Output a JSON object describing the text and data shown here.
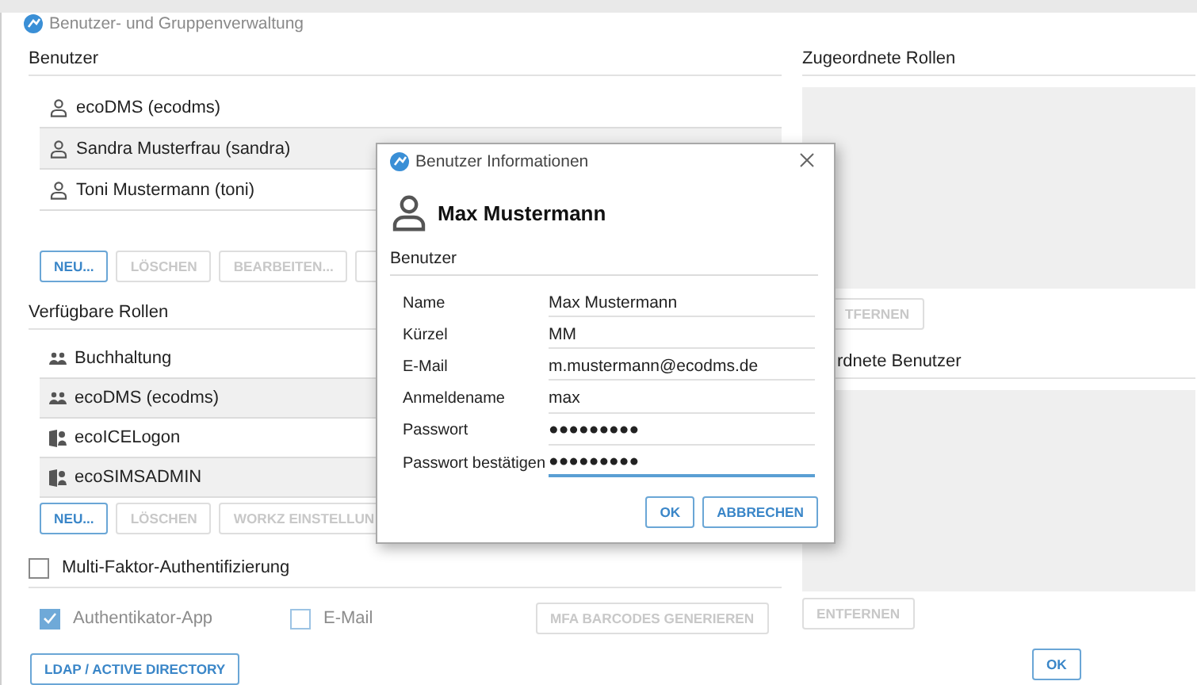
{
  "window": {
    "title": "Benutzer- und Gruppenverwaltung"
  },
  "users": {
    "title": "Benutzer",
    "items": [
      {
        "name": "ecoDMS (ecodms)"
      },
      {
        "name": "Sandra Musterfrau (sandra)"
      },
      {
        "name": "Toni Mustermann (toni)"
      }
    ],
    "buttons": [
      {
        "label": "NEU...",
        "disabled": false
      },
      {
        "label": "LÖSCHEN",
        "disabled": true
      },
      {
        "label": "BEARBEITEN...",
        "disabled": true
      },
      {
        "disabled": true
      }
    ]
  },
  "roles": {
    "title": "Verfügbare Rollen",
    "items": [
      {
        "name": "Buchhaltung",
        "kind": "group"
      },
      {
        "name": "ecoDMS (ecodms)",
        "kind": "group"
      },
      {
        "name": "ecoICELogon",
        "kind": "app"
      },
      {
        "name": "ecoSIMSADMIN",
        "kind": "app"
      }
    ],
    "buttons": [
      {
        "label": "NEU...",
        "disabled": false
      },
      {
        "label": "LÖSCHEN",
        "disabled": true
      },
      {
        "label": "WORKZ EINSTELLUN",
        "disabled": true
      }
    ]
  },
  "mfa": {
    "label": "Multi-Faktor-Authentifizierung",
    "checked": false,
    "options": [
      {
        "label": "Authentikator-App",
        "checked": true,
        "disabled": true
      },
      {
        "label": "E-Mail",
        "checked": false,
        "disabled": true
      }
    ],
    "button": {
      "label": "MFA BARCODES GENERIEREN",
      "disabled": true
    }
  },
  "ldap_button": {
    "label": "LDAP / ACTIVE DIRECTORY",
    "disabled": false
  },
  "assigned_roles": {
    "title": "Zugeordnete Rollen",
    "button": {
      "label": "TFERNEN",
      "disabled": true
    }
  },
  "assigned_users": {
    "title": "rdnete Benutzer",
    "button": {
      "label": "ENTFERNEN",
      "disabled": true
    }
  },
  "ok_button": {
    "label": "OK",
    "disabled": false
  },
  "dialog": {
    "title": "Benutzer Informationen",
    "user_name": "Max Mustermann",
    "section": "Benutzer",
    "fields": [
      {
        "label": "Name",
        "value": "Max Mustermann",
        "focused": false
      },
      {
        "label": "Kürzel",
        "value": "MM",
        "focused": false
      },
      {
        "label": "E-Mail",
        "value": "m.mustermann@ecodms.de",
        "focused": false
      },
      {
        "label": "Anmeldename",
        "value": "max",
        "focused": false
      },
      {
        "label": "Passwort",
        "value": "●●●●●●●●●",
        "focused": false
      },
      {
        "label": "Passwort bestätigen",
        "value": "●●●●●●●●●",
        "focused": true
      }
    ],
    "buttons": [
      {
        "label": "OK",
        "disabled": false
      },
      {
        "label": "ABBRECHEN",
        "disabled": false
      }
    ]
  }
}
